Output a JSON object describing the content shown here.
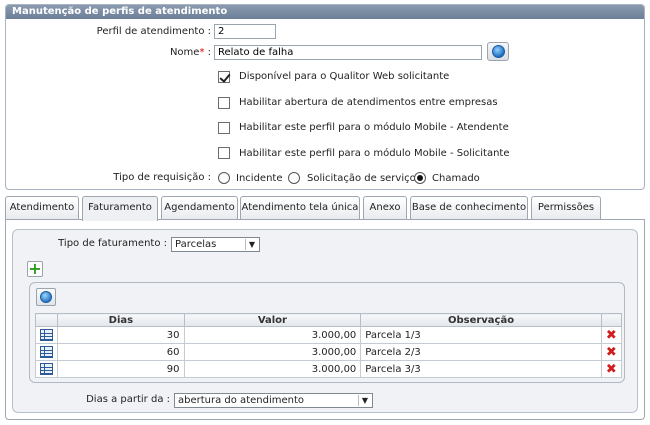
{
  "form": {
    "title": "Manutenção de perfis de atendimento",
    "perfil_label": "Perfil de atendimento :",
    "perfil_value": "2",
    "nome_label": "Nome",
    "nome_req": "*",
    "nome_colon": ":",
    "nome_value": "Relato de falha",
    "checkboxes": [
      {
        "label": "Disponível para o Qualitor Web solicitante",
        "checked": true
      },
      {
        "label": "Habilitar abertura de atendimentos entre empresas",
        "checked": false
      },
      {
        "label": "Habilitar este perfil para o módulo Mobile - Atendente",
        "checked": false
      },
      {
        "label": "Habilitar este perfil para o módulo Mobile - Solicitante",
        "checked": false
      }
    ],
    "tipo_label": "Tipo de requisição :",
    "radios": [
      {
        "label": "Incidente",
        "checked": false
      },
      {
        "label": "Solicitação de serviço",
        "checked": false
      },
      {
        "label": "Chamado",
        "checked": true
      }
    ]
  },
  "tabs": [
    {
      "label": "Atendimento"
    },
    {
      "label": "Faturamento",
      "active": true
    },
    {
      "label": "Agendamento"
    },
    {
      "label": "Atendimento tela única"
    },
    {
      "label": "Anexo"
    },
    {
      "label": "Base de conhecimento"
    },
    {
      "label": "Permissões"
    }
  ],
  "faturamento": {
    "tipo_label": "Tipo de faturamento :",
    "tipo_value": "Parcelas",
    "dias_label": "Dias a partir da :",
    "dias_value": "abertura do atendimento",
    "table": {
      "headers": [
        "Dias",
        "Valor",
        "Observação"
      ],
      "rows": [
        {
          "dias": "30",
          "valor": "3.000,00",
          "obs": "Parcela 1/3"
        },
        {
          "dias": "60",
          "valor": "3.000,00",
          "obs": "Parcela 2/3"
        },
        {
          "dias": "90",
          "valor": "3.000,00",
          "obs": "Parcela 3/3"
        }
      ]
    }
  },
  "icons": {
    "globe": "globe-icon",
    "add": "add-icon",
    "refresh": "refresh-globe-icon",
    "row": "edit-row-icon",
    "delete": "delete-icon",
    "dropdown": "chevron-down-icon"
  }
}
